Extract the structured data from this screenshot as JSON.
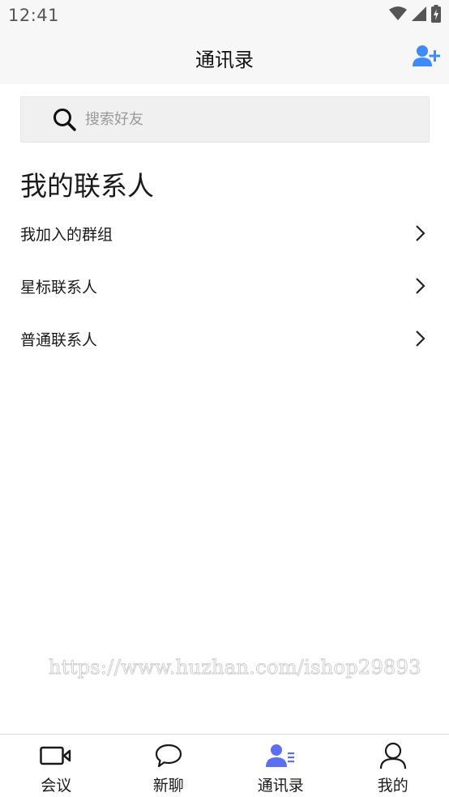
{
  "status_bar": {
    "time": "12:41",
    "icons": [
      "wifi-icon",
      "cell-signal-icon",
      "battery-charging-icon"
    ]
  },
  "header": {
    "title": "通讯录",
    "add_contact_icon": "add-user-icon"
  },
  "search": {
    "placeholder": "搜索好友",
    "value": "",
    "icon": "search-icon"
  },
  "section": {
    "title": "我的联系人"
  },
  "contact_groups": [
    {
      "label": "我加入的群组",
      "icon": "chevron-right-icon"
    },
    {
      "label": "星标联系人",
      "icon": "chevron-right-icon"
    },
    {
      "label": "普通联系人",
      "icon": "chevron-right-icon"
    }
  ],
  "watermark": "https://www.huzhan.com/ishop29893",
  "tabs": [
    {
      "label": "会议",
      "icon": "video-camera-icon",
      "active": false
    },
    {
      "label": "新聊",
      "icon": "chat-bubble-icon",
      "active": false
    },
    {
      "label": "通讯录",
      "icon": "contacts-icon",
      "active": true
    },
    {
      "label": "我的",
      "icon": "person-icon",
      "active": false
    }
  ],
  "colors": {
    "accent": "#5b6ff0",
    "add_icon": "#3d8bfd",
    "header_bg": "#f7f7f7",
    "search_bg": "#f0f0f0",
    "icon_dark": "#111111"
  }
}
